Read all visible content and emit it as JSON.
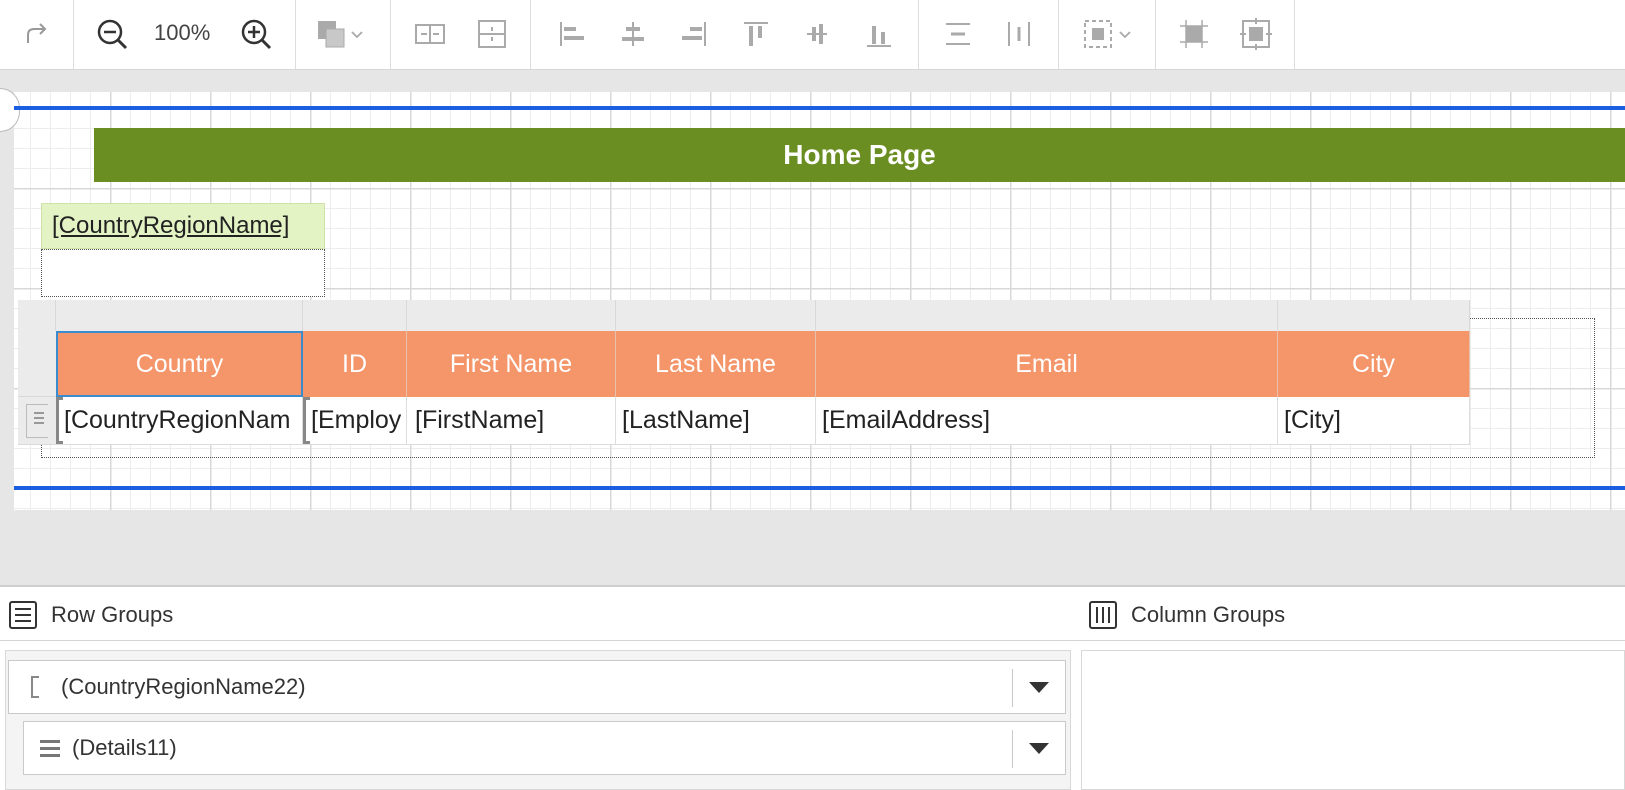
{
  "toolbar": {
    "zoom_level": "100%",
    "icons": [
      "redo-icon",
      "zoom-out-icon",
      "zoom-in-icon",
      "fill-color-icon",
      "chevron-down-icon",
      "split-horizontal-icon",
      "split-vertical-icon",
      "align-left-icon",
      "align-center-icon",
      "align-right-icon",
      "align-top-icon",
      "align-middle-icon",
      "align-bottom-icon",
      "distribute-horizontal-icon",
      "distribute-vertical-icon",
      "selection-icon",
      "chevron-down-icon",
      "size-to-grid-icon",
      "center-in-container-icon"
    ]
  },
  "report": {
    "title": "Home Page",
    "country_field": "[CountryRegionName]",
    "table": {
      "headers": [
        "Country",
        "ID",
        "First Name",
        "Last Name",
        "Email",
        "City"
      ],
      "row": [
        "[CountryRegionNam",
        "[Employ",
        "[FirstName]",
        "[LastName]",
        "[EmailAddress]",
        "[City]"
      ]
    }
  },
  "groups": {
    "row_groups_label": "Row Groups",
    "column_groups_label": "Column Groups",
    "row_groups": [
      {
        "name": "(CountryRegionName22)"
      },
      {
        "name": "(Details11)"
      }
    ]
  },
  "colors": {
    "title_bg": "#6b8e23",
    "header_bg": "#f4956a",
    "field_bg": "#e3f3c4",
    "band_line": "#1a5fe0"
  }
}
